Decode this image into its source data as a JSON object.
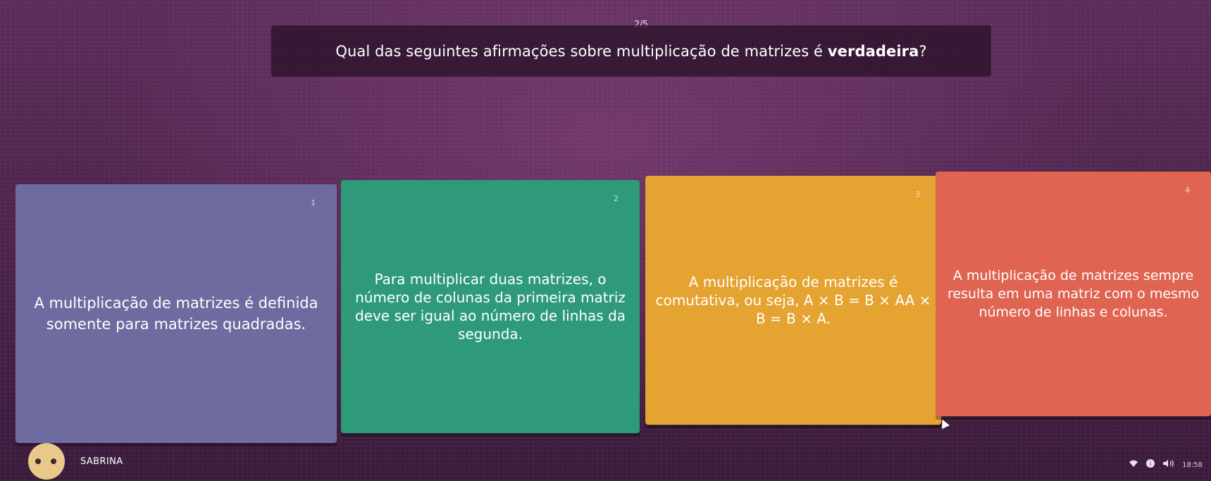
{
  "progress": {
    "counter": "2/5"
  },
  "question": {
    "text_before": "Qual das seguintes afirmações sobre multiplicação de matrizes é ",
    "text_bold": "verdadeira",
    "text_after": "?"
  },
  "answers": [
    {
      "number": "1",
      "text": "A multiplicação de matrizes é definida somente para matrizes quadradas.",
      "color": "#6e6ba0"
    },
    {
      "number": "2",
      "text": "Para multiplicar duas matrizes, o número de colunas da primeira matriz deve ser igual ao número de linhas da segunda.",
      "color": "#2e9a7a"
    },
    {
      "number": "3",
      "text": "A multiplicação de matrizes é comutativa, ou seja, A × B = B × AA × B = B × A.",
      "color": "#e5a331"
    },
    {
      "number": "4",
      "text": "A multiplicação de matrizes sempre resulta em uma matriz com o mesmo número de linhas e colunas.",
      "color": "#e06452"
    }
  ],
  "user": {
    "name": "SABRINA"
  },
  "system_tray": {
    "icons": [
      "wifi-icon",
      "notification-icon",
      "volume-icon"
    ],
    "time": "18:58"
  }
}
